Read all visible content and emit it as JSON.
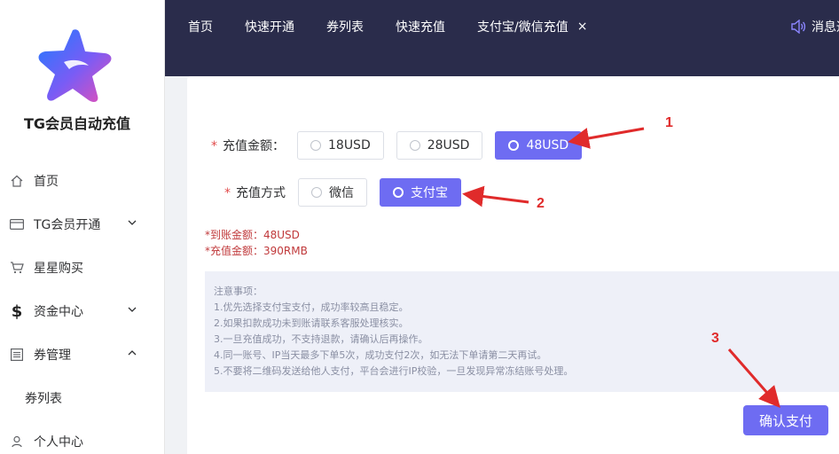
{
  "sidebar": {
    "brand": "TG会员自动充值",
    "items": [
      {
        "label": "首页"
      },
      {
        "label": "TG会员开通"
      },
      {
        "label": "星星购买"
      },
      {
        "label": "资金中心"
      },
      {
        "label": "券管理"
      },
      {
        "label": "券列表"
      },
      {
        "label": "个人中心"
      }
    ]
  },
  "header": {
    "tabs": [
      "首页",
      "快速开通",
      "券列表",
      "快速充值",
      "支付宝/微信充值"
    ],
    "close_icon": "×",
    "messages": "消息通"
  },
  "form": {
    "amount_label": "充值金额：",
    "amount_options": [
      "18USD",
      "28USD",
      "48USD"
    ],
    "amount_selected": "48USD",
    "method_label": "充值方式",
    "method_options": [
      "微信",
      "支付宝"
    ],
    "method_selected": "支付宝",
    "arrival": "*到账金额：48USD",
    "recharge": "*充值金额：390RMB"
  },
  "notice": {
    "title": "注意事项：",
    "lines": [
      "1.优先选择支付宝支付，成功率较高且稳定。",
      "2.如果扣款成功未到账请联系客服处理核实。",
      "3.一旦充值成功，不支持退款，请确认后再操作。",
      "4.同一账号、IP当天最多下单5次，成功支付2次，如无法下单请第二天再试。",
      "5.不要将二维码发送给他人支付，平台会进行IP校验，一旦发现异常冻结账号处理。"
    ]
  },
  "confirm_label": "确认支付",
  "annotations": [
    "1",
    "2",
    "3"
  ],
  "colors": {
    "accent": "#6e6cf2",
    "header": "#2a2c4b",
    "arrow": "#e02b2b"
  }
}
